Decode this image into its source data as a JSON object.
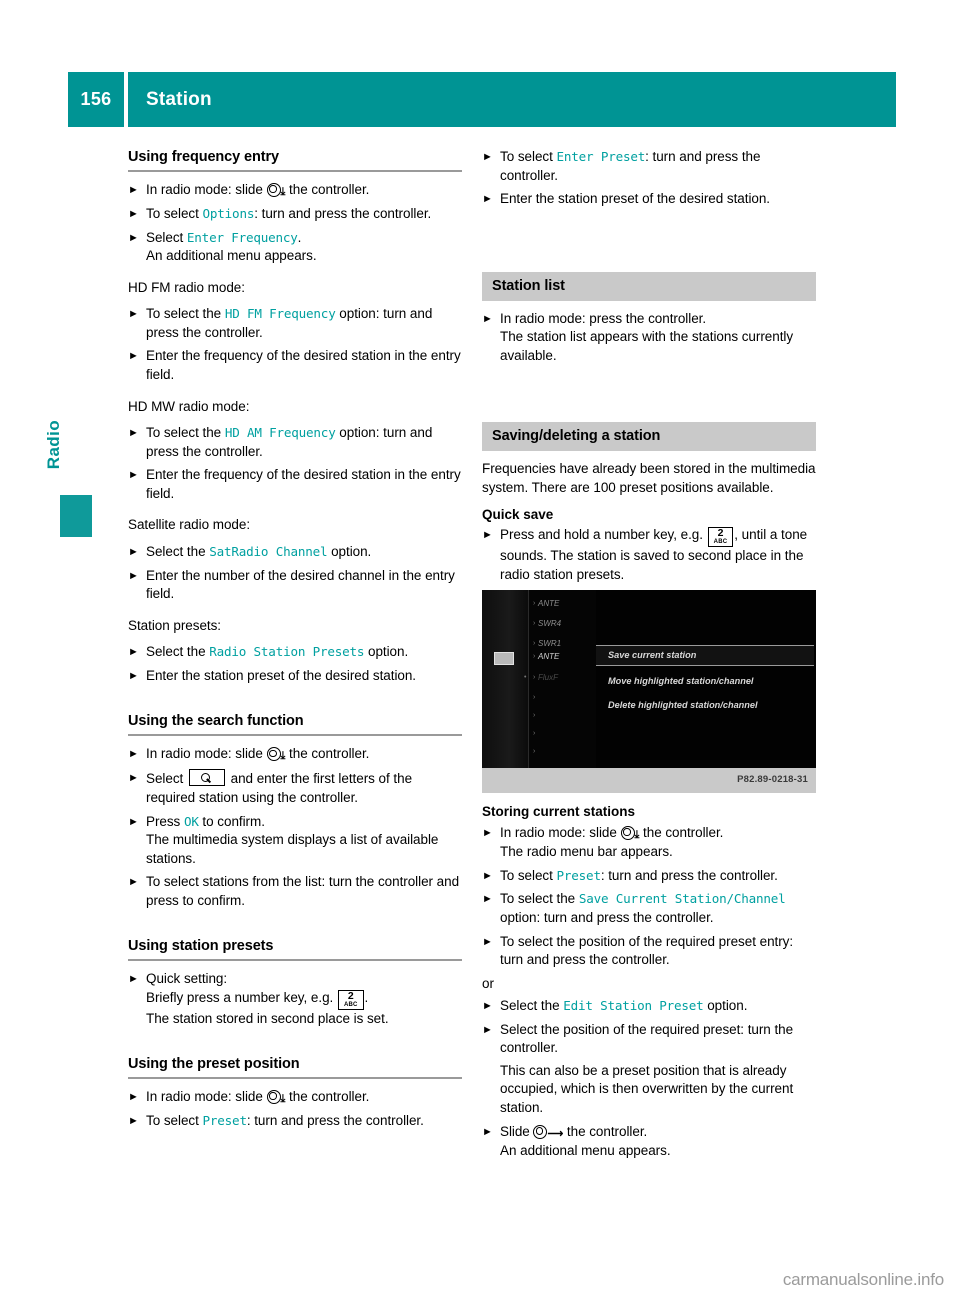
{
  "header": {
    "page_number": "156",
    "title": "Station"
  },
  "margin_tab": {
    "label": "Radio"
  },
  "left_column": {
    "section1": {
      "heading": "Using frequency entry",
      "items": [
        {
          "pre": "In radio mode: slide ",
          "ctrl": "down",
          "post": " the controller."
        },
        {
          "pre": "To select ",
          "mono": "Options",
          "post": ": turn and press the controller."
        },
        {
          "pre": "Select ",
          "mono": "Enter Frequency",
          "post": ".",
          "cont": "An additional menu appears."
        }
      ],
      "para_hdfm": "HD FM radio mode:",
      "items_hdfm": [
        {
          "pre": "To select the ",
          "mono": "HD FM Frequency",
          "post": " option: turn and press the controller."
        },
        {
          "pre": "Enter the frequency of the desired station in the entry field."
        }
      ],
      "para_hdmw": "HD MW radio mode:",
      "items_hdmw": [
        {
          "pre": "To select the ",
          "mono": "HD AM Frequency",
          "post": " option: turn and press the controller."
        },
        {
          "pre": "Enter the frequency of the desired station in the entry field."
        }
      ],
      "para_sat": "Satellite radio mode:",
      "items_sat": [
        {
          "pre": "Select the ",
          "mono": "SatRadio Channel",
          "post": " option."
        },
        {
          "pre": "Enter the number of the desired channel in the entry field."
        }
      ],
      "para_presets": "Station presets:",
      "items_presets": [
        {
          "pre": "Select the ",
          "mono": "Radio Station Presets",
          "post": " option."
        },
        {
          "pre": "Enter the station preset of the desired station."
        }
      ]
    },
    "section2": {
      "heading": "Using the search function",
      "items": [
        {
          "pre": "In radio mode: slide ",
          "ctrl": "down",
          "post": " the controller."
        },
        {
          "pre": "Select ",
          "icon": "search",
          "post": " and enter the first letters of the required station using the controller."
        },
        {
          "pre": "Press ",
          "mono": "OK",
          "post": " to confirm.",
          "cont": "The multimedia system displays a list of available stations."
        },
        {
          "pre": "To select stations from the list: turn the controller and press to confirm."
        }
      ]
    },
    "section3": {
      "heading": "Using station presets",
      "items": [
        {
          "pre": "Quick setting:",
          "cont_pre": "Briefly press a number key, e.g. ",
          "key_num": "2",
          "key_abc": "ABC",
          "cont_post": ".",
          "cont2": "The station stored in second place is set."
        }
      ]
    },
    "section4": {
      "heading": "Using the preset position",
      "items": [
        {
          "pre": "In radio mode: slide ",
          "ctrl": "down",
          "post": " the controller."
        },
        {
          "pre": "To select ",
          "mono": "Preset",
          "post": ": turn and press the controller."
        }
      ]
    }
  },
  "right_column": {
    "top_items": [
      {
        "pre": "To select ",
        "mono": "Enter Preset",
        "post": ": turn and press the controller."
      },
      {
        "pre": "Enter the station preset of the desired station."
      }
    ],
    "station_list": {
      "heading": "Station list",
      "items": [
        {
          "pre": "In radio mode: press the controller.",
          "cont": "The station list appears with the stations currently available."
        }
      ]
    },
    "saving": {
      "heading": "Saving/deleting a station",
      "intro": "Frequencies have already been stored in the multimedia system. There are 100 preset positions available.",
      "sub_heading": "Quick save",
      "items": [
        {
          "pre": "Press and hold a number key, e.g. ",
          "key_num": "2",
          "key_abc": "ABC",
          "post": ", until a tone sounds. The station is saved to second place in the radio station presets."
        }
      ]
    },
    "figure": {
      "code": "P82.89-0218-31",
      "station_entries": [
        "ANTE",
        "SWR4",
        "SWR1",
        "ANTE",
        "FluxF"
      ],
      "menu_items": [
        "Save current station",
        "Move highlighted station/channel",
        "Delete highlighted station/channel"
      ],
      "selected_menu_item": "Save current station"
    },
    "storing": {
      "heading": "Storing current stations",
      "items": [
        {
          "pre": "In radio mode: slide ",
          "ctrl": "down",
          "post": " the controller.",
          "cont": "The radio menu bar appears."
        },
        {
          "pre": "To select ",
          "mono": "Preset",
          "post": ": turn and press the controller."
        },
        {
          "pre": "To select the ",
          "mono": "Save Current Station/Channel",
          "post": " option: turn and press the controller."
        },
        {
          "pre": "To select the position of the required preset entry: turn and press the controller."
        }
      ],
      "or_label": "or",
      "items_after_or": [
        {
          "pre": "Select the ",
          "mono": "Edit Station Preset",
          "post": " option."
        },
        {
          "pre": "Select the position of the required preset: turn the controller.",
          "cont": "This can also be a preset position that is already occupied, which is then overwritten by the current station."
        },
        {
          "pre": "Slide ",
          "ctrl": "right",
          "post": " the controller.",
          "cont": "An additional menu appears."
        }
      ]
    }
  },
  "watermark": "carmanualsonline.info",
  "colors": {
    "teal": "#009494",
    "mono_teal": "#00a0a0",
    "gray_band": "#c9c9c9",
    "rule": "#9a9a9a"
  }
}
